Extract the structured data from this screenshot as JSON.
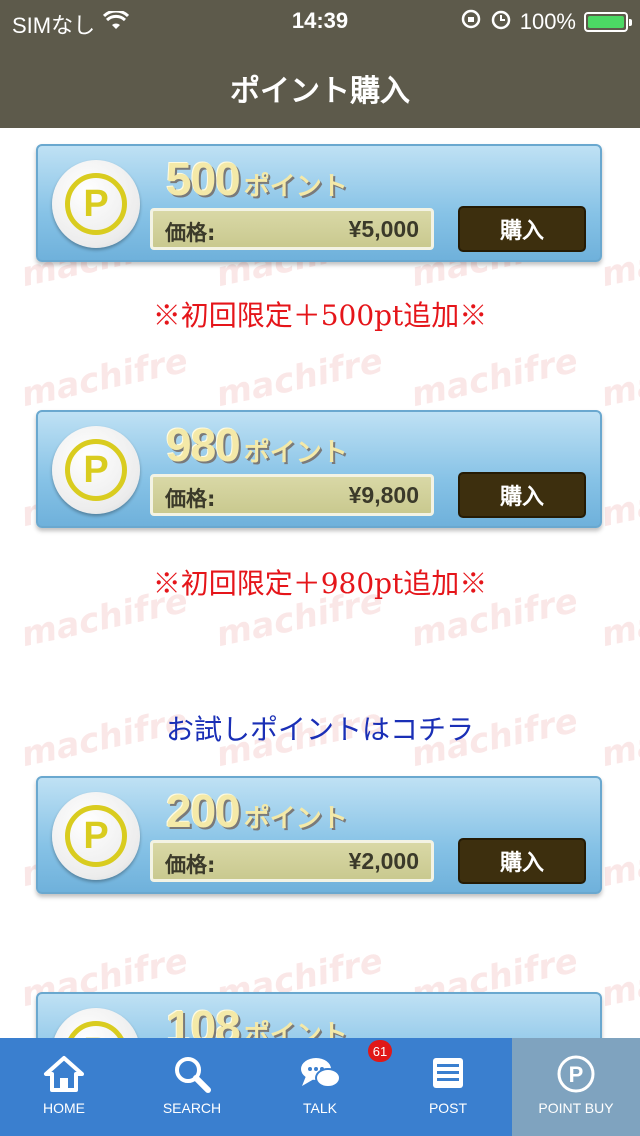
{
  "status_bar": {
    "carrier": "SIMなし",
    "time": "14:39",
    "battery": "100%",
    "battery_level": 1.0
  },
  "nav": {
    "title": "ポイント購入"
  },
  "watermark_text": "machifre",
  "packages": [
    {
      "points": "500",
      "unit": "ポイント",
      "price_label": "価格:",
      "price": "¥5,000",
      "buy_label": "購入",
      "bonus": "※初回限定＋500pt追加※"
    },
    {
      "points": "980",
      "unit": "ポイント",
      "price_label": "価格:",
      "price": "¥9,800",
      "buy_label": "購入",
      "bonus": "※初回限定＋980pt追加※"
    },
    {
      "points": "200",
      "unit": "ポイント",
      "price_label": "価格:",
      "price": "¥2,000",
      "buy_label": "購入"
    },
    {
      "points": "108",
      "unit": "ポイント"
    }
  ],
  "trial_link": "お試しポイントはコチラ",
  "coin_symbol": "P",
  "tabs": [
    {
      "label": "HOME",
      "icon": "home-icon"
    },
    {
      "label": "SEARCH",
      "icon": "search-icon"
    },
    {
      "label": "TALK",
      "icon": "chat-bubbles-icon",
      "badge": "61"
    },
    {
      "label": "POST",
      "icon": "post-board-icon"
    },
    {
      "label": "POINT BUY",
      "icon": "point-coin-icon",
      "active": true
    }
  ],
  "colors": {
    "bar_bg": "#5d5a4b",
    "tab_bg": "#3a7fcf",
    "tab_active": "#7fa3bf",
    "bonus_text": "#e5151a",
    "trial_text": "#1a2fb6",
    "buy_button": "#3d2f0e"
  }
}
